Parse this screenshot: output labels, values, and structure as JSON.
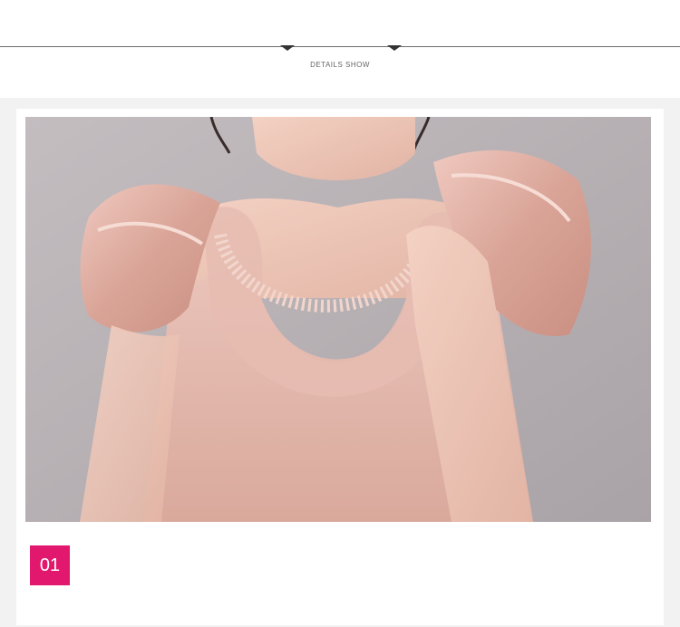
{
  "header": {
    "caption": "DETAILS SHOW"
  },
  "photo": {
    "subject": "girl-in-pink-satin-dress-with-ruffle-sleeves-and-beaded-neckline"
  },
  "badge": {
    "number": "01",
    "color": "#e2186f"
  },
  "colors": {
    "wall": "#b9b3b6",
    "dress": "#e7bdb4",
    "skin": "#efc7b7",
    "hair": "#3a2b2b"
  }
}
